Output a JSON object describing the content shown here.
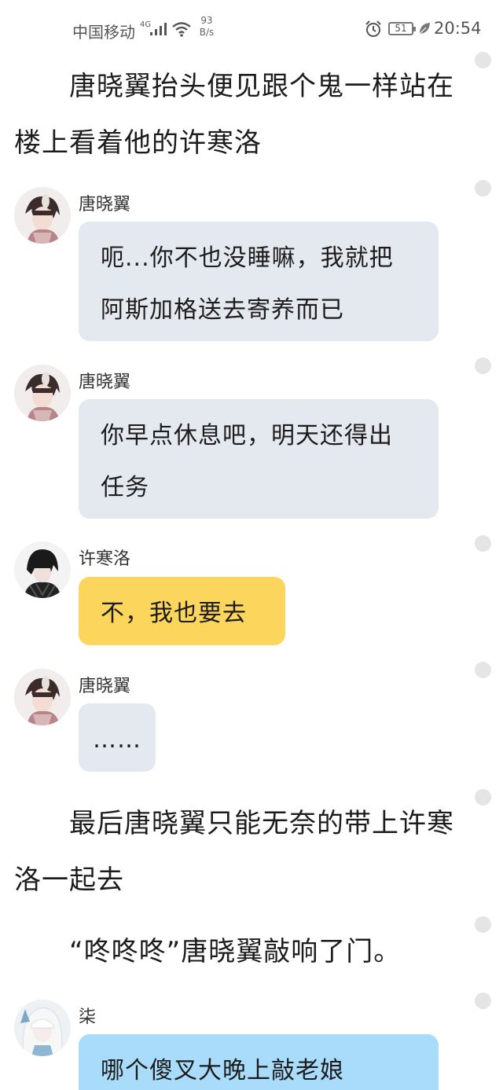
{
  "status_bar": {
    "carrier": "中国移动",
    "network": "4G",
    "speed_value": "93",
    "speed_unit": "B/s",
    "battery": "51",
    "time": "20:54"
  },
  "narration": [
    "唐晓翼抬头便见跟个鬼一样站在楼上看着他的许寒洛",
    "最后唐晓翼只能无奈的带上许寒洛一起去",
    "“咚咚咚”唐晓翼敲响了门。"
  ],
  "messages": [
    {
      "speaker": "唐晓翼",
      "text": "呃...你不也没睡嘛，我就把阿斯加格送去寄养而已",
      "bubble": "gray"
    },
    {
      "speaker": "唐晓翼",
      "text": "你早点休息吧，明天还得出任务",
      "bubble": "gray"
    },
    {
      "speaker": "许寒洛",
      "text": "不，我也要去",
      "bubble": "yellow"
    },
    {
      "speaker": "唐晓翼",
      "text": "……",
      "bubble": "gray"
    },
    {
      "speaker": "柒",
      "text": "哪个傻叉大晚上敲老娘",
      "bubble": "blue"
    }
  ],
  "colors": {
    "bubble_gray": "#e4e8ef",
    "bubble_yellow": "#fbd55c",
    "bubble_blue": "#a9dcfa",
    "side_dot": "#e5e5e5"
  }
}
